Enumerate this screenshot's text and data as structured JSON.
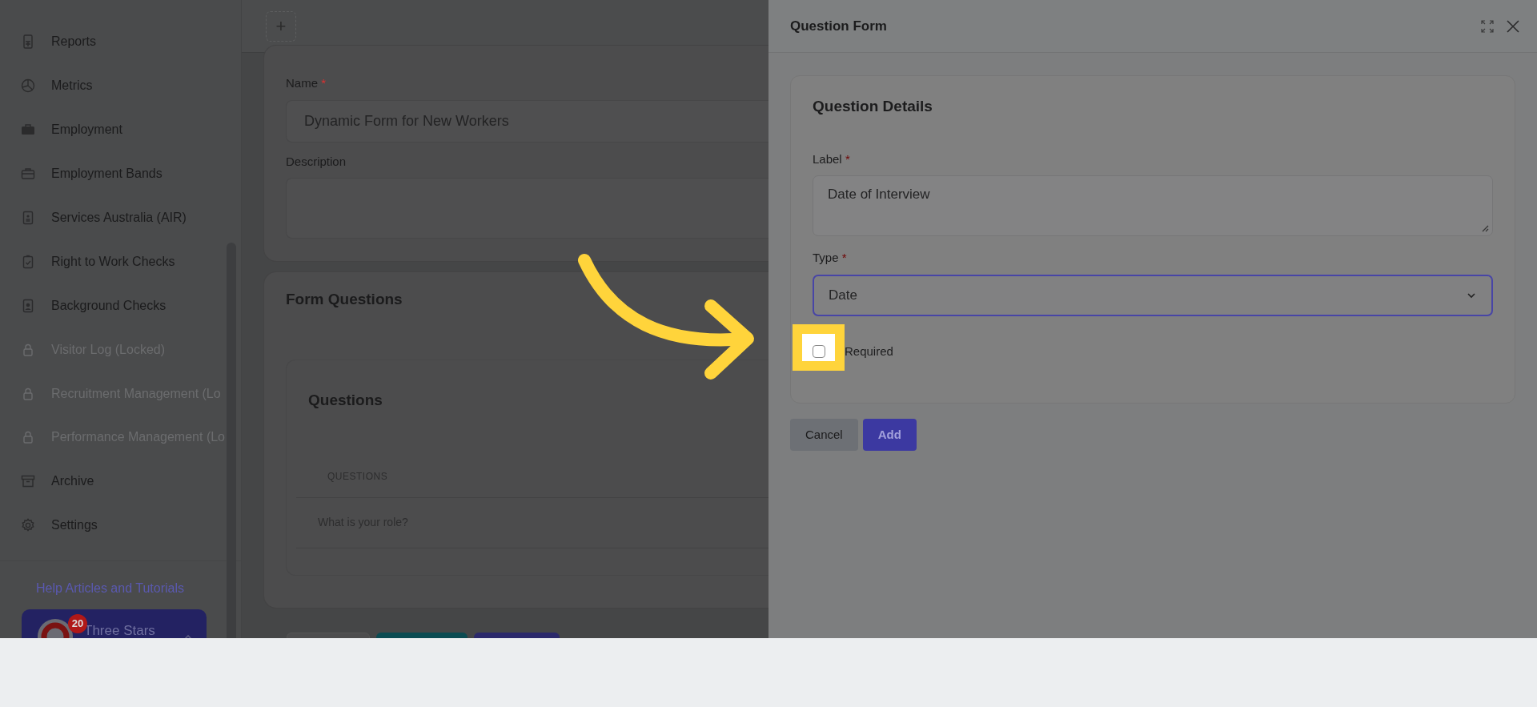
{
  "sidebar": {
    "items": [
      {
        "label": "Reports",
        "disabled": false
      },
      {
        "label": "Metrics",
        "disabled": false
      },
      {
        "label": "Employment",
        "disabled": false
      },
      {
        "label": "Employment Bands",
        "disabled": false
      },
      {
        "label": "Services Australia (AIR)",
        "disabled": false
      },
      {
        "label": "Right to Work Checks",
        "disabled": false
      },
      {
        "label": "Background Checks",
        "disabled": false
      },
      {
        "label": "Visitor Log (Locked)",
        "disabled": true
      },
      {
        "label": "Recruitment Management (Lo",
        "disabled": true
      },
      {
        "label": "Performance Management (Lo",
        "disabled": true
      },
      {
        "label": "Archive",
        "disabled": false
      },
      {
        "label": "Settings",
        "disabled": false
      }
    ],
    "help_link": "Help Articles and Tutorials",
    "account": {
      "name": "Three Stars",
      "badge": "20"
    }
  },
  "toolbar": {
    "add_button": "+"
  },
  "form": {
    "name_label": "Name",
    "name_required_mark": "*",
    "name_value": "Dynamic Form for New Workers",
    "description_label": "Description"
  },
  "questions_section": {
    "title": "Form Questions",
    "card_title": "Questions",
    "column": "QUESTIONS",
    "rows": [
      "What is your role?"
    ]
  },
  "panel": {
    "title": "Question Form",
    "section_title": "Question Details",
    "fields": [
      {
        "kind": "textarea",
        "label": "Label",
        "required_mark": "*",
        "value": "Date of Interview",
        "focused": false
      },
      {
        "kind": "select",
        "label": "Type",
        "required_mark": "*",
        "value": "Date",
        "focused": true
      }
    ],
    "checkbox": {
      "label": "Required",
      "checked": false
    },
    "buttons": [
      {
        "label": "Cancel",
        "kind": "secondary"
      },
      {
        "label": "Add",
        "kind": "primary"
      }
    ]
  }
}
